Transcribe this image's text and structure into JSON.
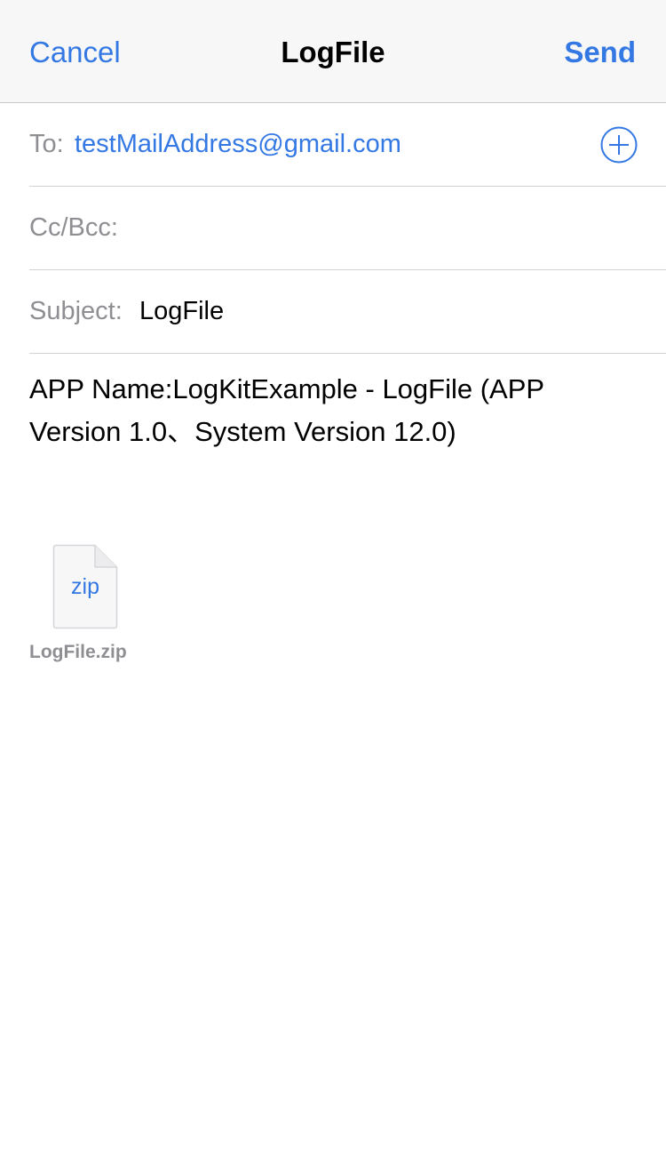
{
  "navbar": {
    "cancel_label": "Cancel",
    "title": "LogFile",
    "send_label": "Send"
  },
  "fields": {
    "to_label": "To:",
    "to_value": "testMailAddress@gmail.com",
    "cc_label": "Cc/Bcc:",
    "cc_value": "",
    "subject_label": "Subject:",
    "subject_value": "LogFile"
  },
  "body": {
    "line1": "APP Name:LogKitExample - LogFile (APP",
    "line2": "Version 1.0、System Version 12.0)"
  },
  "attachment": {
    "extension": "zip",
    "filename": "LogFile.zip"
  },
  "icons": {
    "add_contact": "plus-circle-icon",
    "attachment": "document-icon"
  },
  "colors": {
    "accent": "#3478e4",
    "secondary_text": "#8e8e93",
    "navbar_background": "#f7f7f7",
    "separator": "#d1d1d6"
  }
}
